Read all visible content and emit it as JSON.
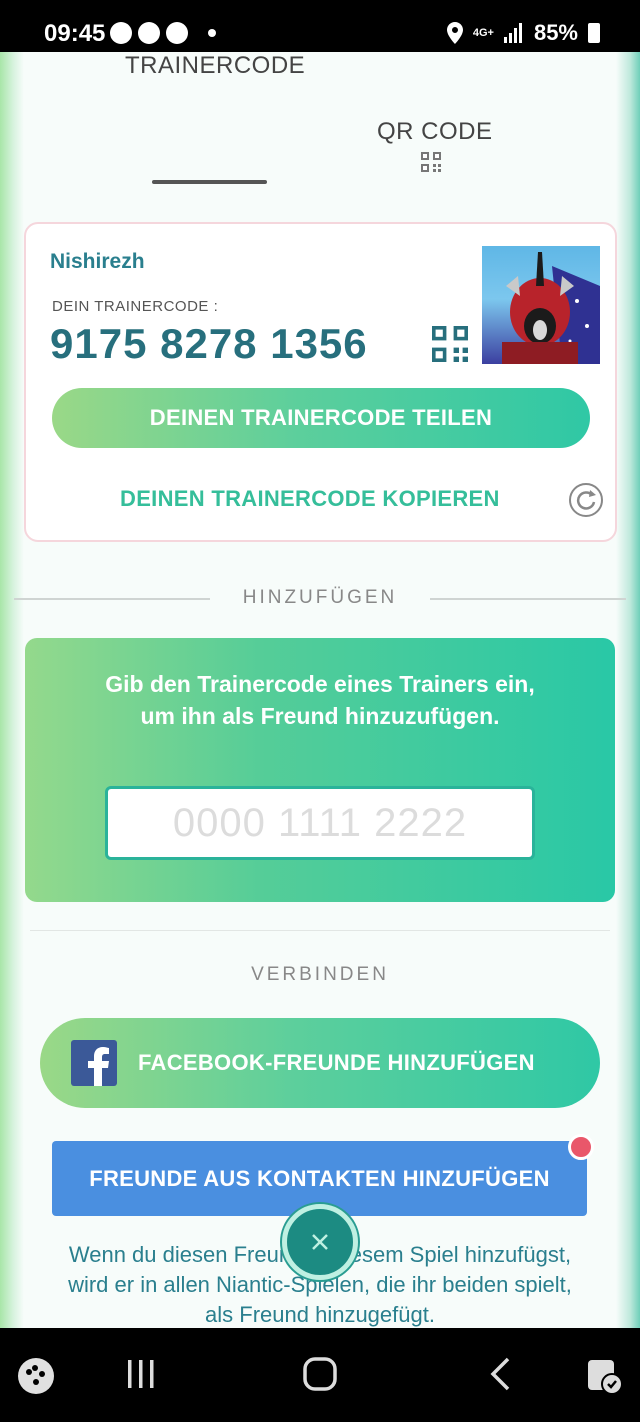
{
  "status_bar": {
    "time": "09:45",
    "network": "4G+",
    "battery": "85%"
  },
  "tabs": [
    {
      "label": "TRAINERCODE",
      "active": true
    },
    {
      "label": "QR CODE",
      "active": false
    }
  ],
  "profile": {
    "name": "Nishirezh",
    "code_label": "DEIN TRAINERCODE :",
    "code": "9175 8278 1356",
    "share_label": "DEINEN TRAINERCODE TEILEN",
    "copy_label": "DEINEN TRAINERCODE KOPIEREN"
  },
  "add_section": {
    "title": "HINZUFÜGEN",
    "instruction": "Gib den Trainercode eines Trainers ein, um ihn als Freund hinzuzufügen.",
    "input_placeholder": "0000 1111 2222"
  },
  "connect_section": {
    "title": "VERBINDEN",
    "facebook_label": "FACEBOOK-FREUNDE HINZUFÜGEN",
    "contacts_label": "FREUNDE AUS KONTAKTEN HINZUFÜGEN",
    "disclaimer": "Wenn du diesen Freund in diesem Spiel hinzufügst, wird er in allen Niantic-Spielen, die ihr beiden spielt, als Freund hinzugefügt."
  },
  "colors": {
    "accent_teal": "#2a7f8e",
    "button_green_start": "#9ad887",
    "button_green_end": "#2fc8a5",
    "contacts_blue": "#4a8fe0",
    "badge_red": "#e9576a"
  }
}
